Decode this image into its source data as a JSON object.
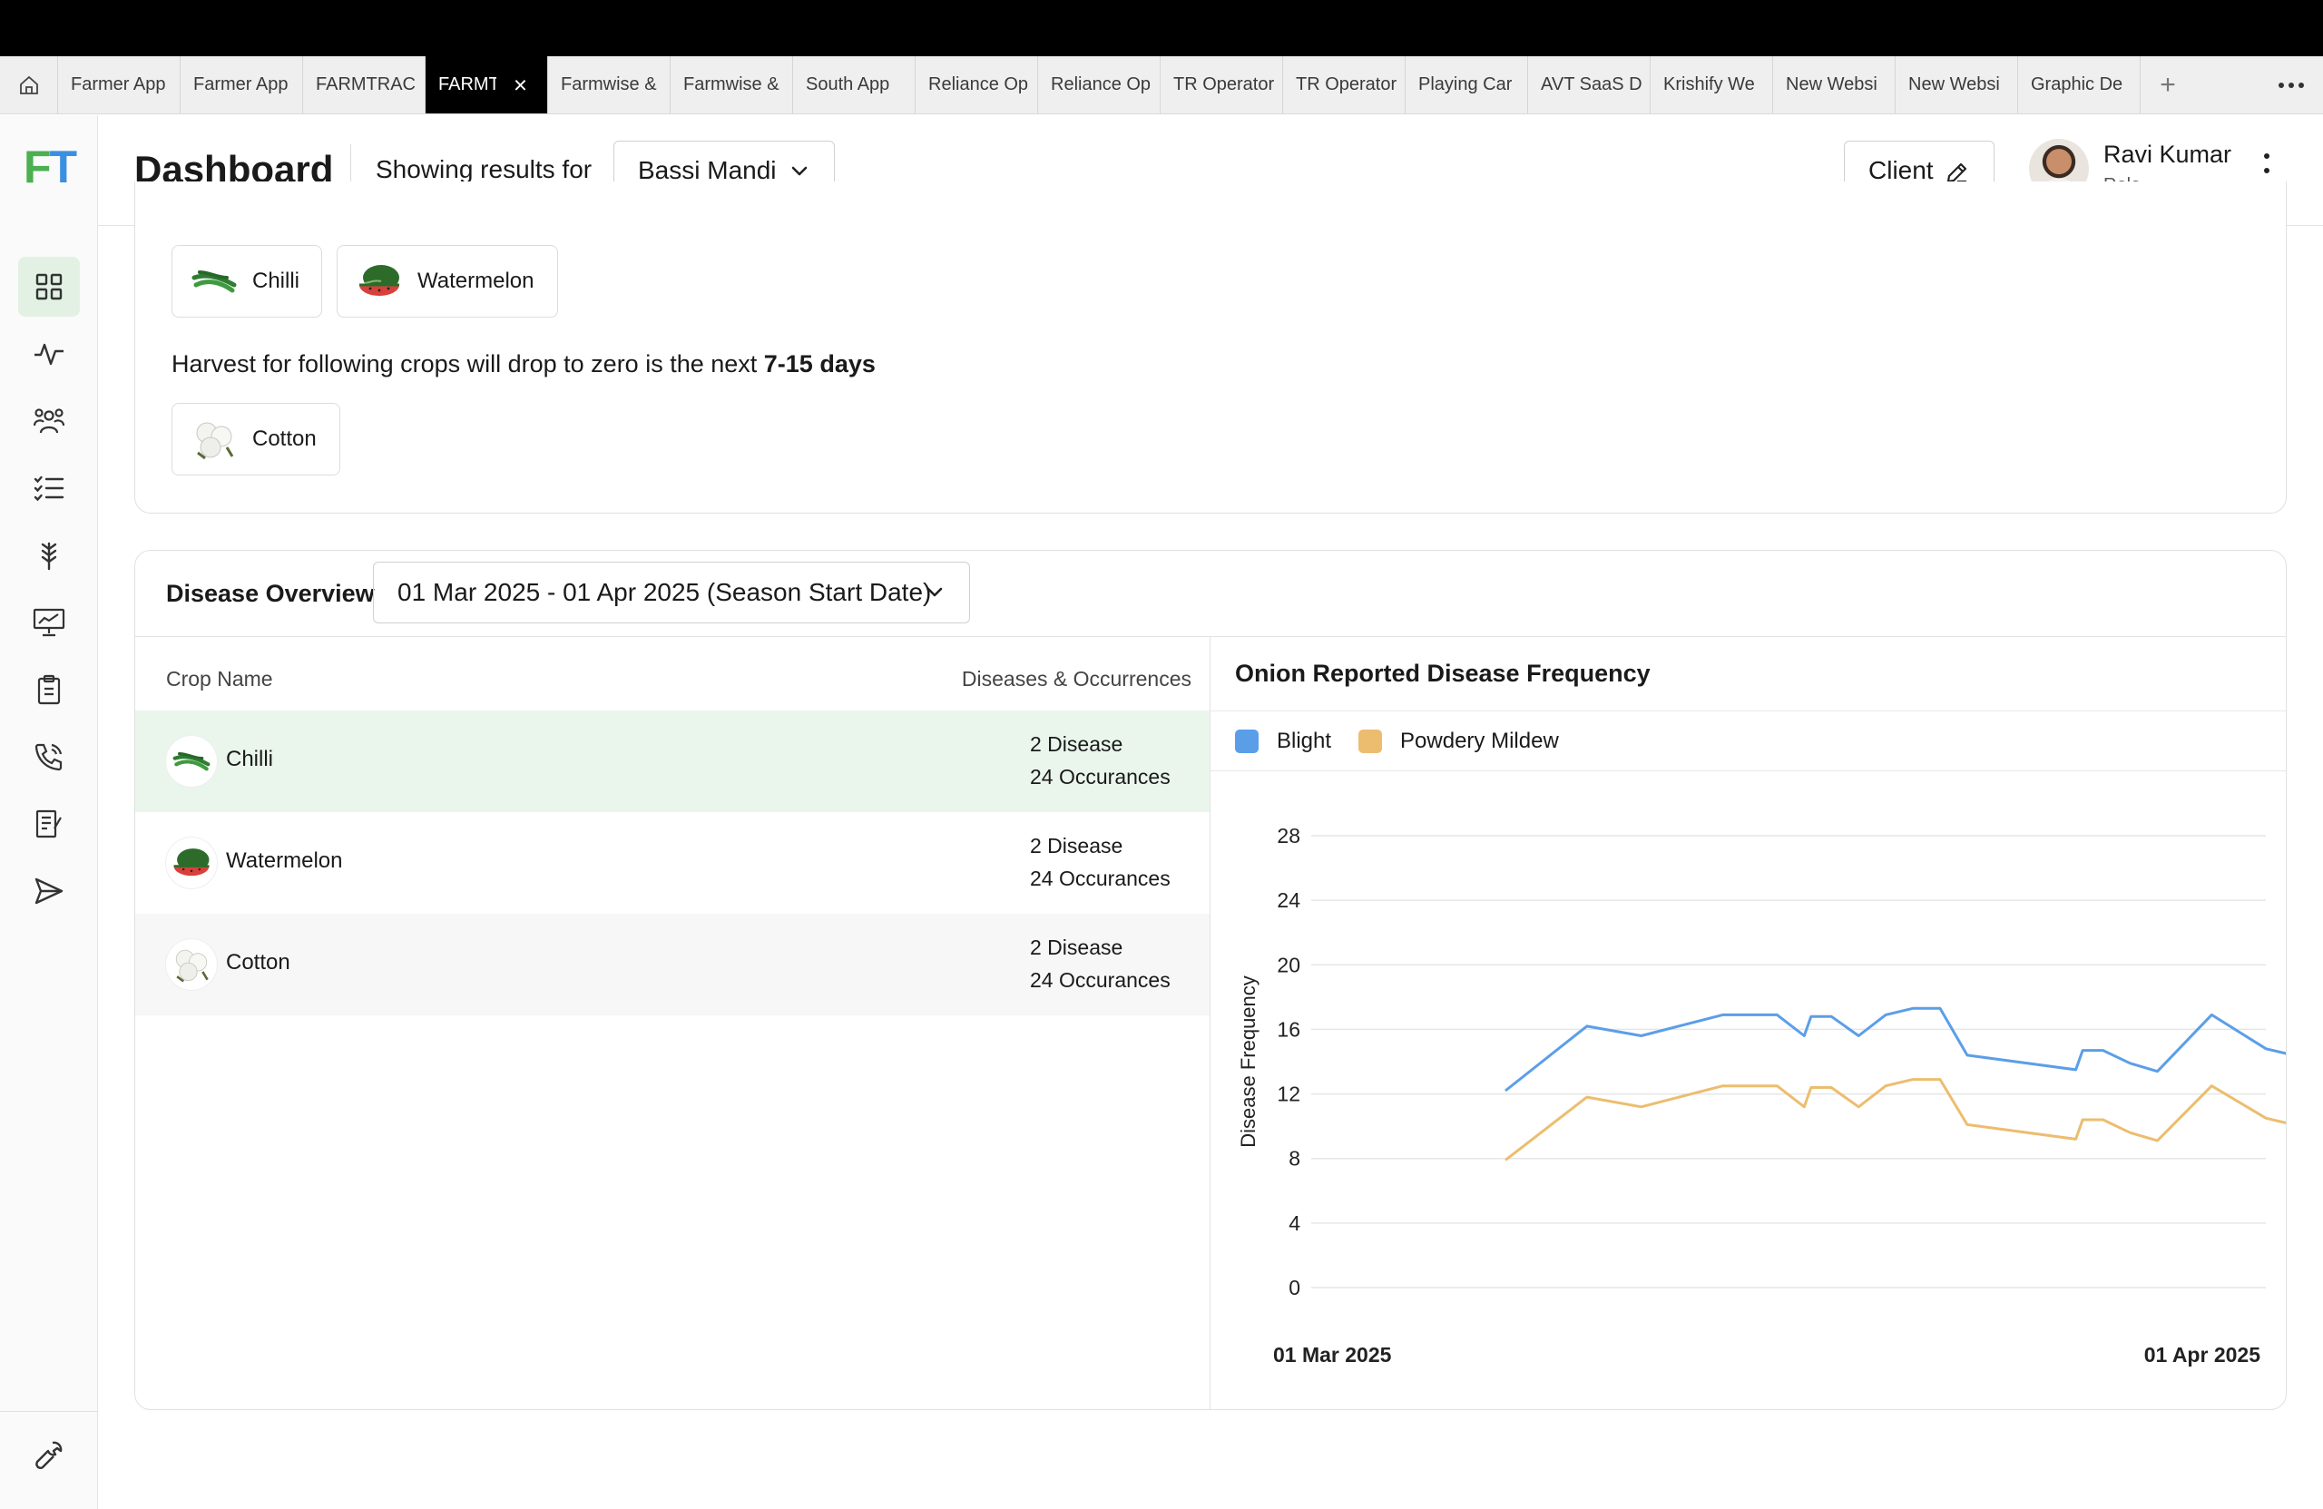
{
  "browser": {
    "tabs": [
      {
        "label": "Farmer App",
        "active": false
      },
      {
        "label": "Farmer App",
        "active": false
      },
      {
        "label": "FARMTRAC",
        "active": false
      },
      {
        "label": "FARMTRAC",
        "active": true
      },
      {
        "label": "Farmwise &",
        "active": false
      },
      {
        "label": "Farmwise &",
        "active": false
      },
      {
        "label": "South App",
        "active": false
      },
      {
        "label": "Reliance Op",
        "active": false
      },
      {
        "label": "Reliance Op",
        "active": false
      },
      {
        "label": "TR Operator",
        "active": false
      },
      {
        "label": "TR Operator",
        "active": false
      },
      {
        "label": "Playing Car",
        "active": false
      },
      {
        "label": "AVT SaaS D",
        "active": false
      },
      {
        "label": "Krishify We",
        "active": false
      },
      {
        "label": "New Websi",
        "active": false
      },
      {
        "label": "New Websi",
        "active": false
      },
      {
        "label": "Graphic De",
        "active": false
      }
    ],
    "new_tab": "+",
    "close_glyph": "×"
  },
  "app": {
    "logo_f": "F",
    "logo_t": "T"
  },
  "sidebar": {
    "items": [
      {
        "name": "dashboard",
        "active": true
      },
      {
        "name": "activity",
        "active": false
      },
      {
        "name": "farmers",
        "active": false
      },
      {
        "name": "tasks",
        "active": false
      },
      {
        "name": "crops",
        "active": false
      },
      {
        "name": "reports",
        "active": false
      },
      {
        "name": "clipboard",
        "active": false
      },
      {
        "name": "calls",
        "active": false
      },
      {
        "name": "documents",
        "active": false
      },
      {
        "name": "send",
        "active": false
      }
    ],
    "bottom": "settings"
  },
  "header": {
    "title": "Dashboard",
    "showing_label": "Showing results for",
    "location": "Bassi Mandi",
    "client_label": "Client",
    "user_name": "Ravi Kumar",
    "user_role": "Role"
  },
  "harvest": {
    "top_crops": [
      "Chilli",
      "Watermelon"
    ],
    "text_prefix": "Harvest for following crops will drop to zero is the next ",
    "text_bold": "7-15 days",
    "drop_crops": [
      "Cotton"
    ]
  },
  "disease": {
    "title": "Disease Overview",
    "date_range": "01 Mar 2025 - 01 Apr 2025 (Season Start Date)",
    "col_crop": "Crop Name",
    "col_diseases": "Diseases & Occurrences",
    "rows": [
      {
        "crop": "Chilli",
        "diseases": "2 Disease",
        "occurrences": "24 Occurances"
      },
      {
        "crop": "Watermelon",
        "diseases": "2 Disease",
        "occurrences": "24 Occurances"
      },
      {
        "crop": "Cotton",
        "diseases": "2 Disease",
        "occurrences": "24 Occurances"
      }
    ]
  },
  "colors": {
    "accent_green": "#4caf50",
    "accent_blue": "#3b8fe0",
    "selected_row": "#eaf6ec",
    "alt_row": "#f7f7f7",
    "blight": "#5b9ee8",
    "powdery_mildew": "#ecbd6f"
  },
  "chart_data": {
    "type": "line",
    "title": "Onion Reported Disease Frequency",
    "ylabel": "Disease Frequency",
    "xlabel": "",
    "x_tick_labels": [
      "01 Mar 2025",
      "01 Apr 2025"
    ],
    "ylim": [
      0,
      28
    ],
    "yticks": [
      0,
      4,
      8,
      12,
      16,
      20,
      24,
      28
    ],
    "grid": true,
    "legend": "top-left",
    "x": [
      "2025-03-01",
      "2025-03-04",
      "2025-03-06",
      "2025-03-09",
      "2025-03-11",
      "2025-03-12",
      "2025-03-12",
      "2025-03-13",
      "2025-03-14",
      "2025-03-15",
      "2025-03-16",
      "2025-03-17",
      "2025-03-18",
      "2025-03-22",
      "2025-03-22",
      "2025-03-23",
      "2025-03-24",
      "2025-03-25",
      "2025-03-27",
      "2025-03-29",
      "2025-03-31",
      "2025-04-01"
    ],
    "series": [
      {
        "name": "Blight",
        "color": "#5b9ee8",
        "values": [
          12.2,
          16.2,
          15.6,
          16.9,
          16.9,
          15.6,
          16.8,
          16.8,
          15.6,
          16.9,
          17.3,
          17.3,
          14.4,
          13.5,
          14.7,
          14.7,
          13.9,
          13.4,
          16.9,
          14.8,
          14.0,
          16.2
        ]
      },
      {
        "name": "Powdery Mildew",
        "color": "#ecbd6f",
        "values": [
          7.9,
          11.8,
          11.2,
          12.5,
          12.5,
          11.2,
          12.4,
          12.4,
          11.2,
          12.5,
          12.9,
          12.9,
          10.1,
          9.2,
          10.4,
          10.4,
          9.6,
          9.1,
          12.5,
          10.5,
          9.7,
          11.9
        ]
      }
    ]
  }
}
